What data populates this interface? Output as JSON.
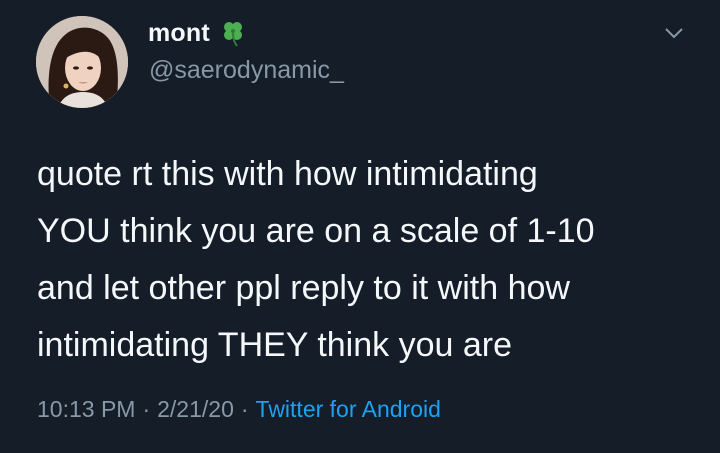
{
  "user": {
    "display_name": "mont",
    "handle": "@saerodynamic_",
    "badge_icon": "four-leaf-clover-icon"
  },
  "tweet": {
    "text": "quote rt this with how intimidating\nYOU think you are on a scale of 1-10\nand let other ppl reply to it with how\nintimidating THEY think you are",
    "time": "10:13 PM",
    "date": "2/21/20",
    "source": "Twitter for Android",
    "separator": "·"
  },
  "colors": {
    "background": "#141d28",
    "text": "#f5f8fa",
    "secondary": "#8899a6",
    "link": "#1da1f2",
    "clover": "#4caf50"
  }
}
